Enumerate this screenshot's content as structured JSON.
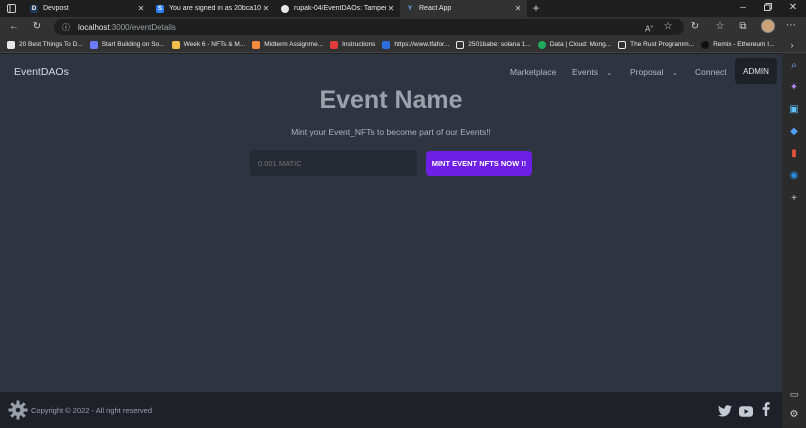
{
  "browser": {
    "tabs": [
      {
        "title": "Devpost",
        "favicon": "D",
        "color": "#1f3b57",
        "active": false
      },
      {
        "title": "You are signed in as 20bca102",
        "favicon": "S",
        "color": "#2d7ff9",
        "active": false
      },
      {
        "title": "rupak-04/EventDAOs: Tamper Pr",
        "favicon": "github-icon",
        "color": "#111111",
        "active": false
      },
      {
        "title": "React App",
        "favicon": "Y",
        "color": "#323233",
        "active": true
      }
    ],
    "address": {
      "host": "localhost",
      "path": ":3000/eventDetails"
    },
    "bookmarks": [
      {
        "label": "20 Best Things To D...",
        "color": "#e8e8e8"
      },
      {
        "label": "Start Building on So...",
        "color": "#6b7cff"
      },
      {
        "label": "Week 6 - NFTs & M...",
        "color": "#f0c04a"
      },
      {
        "label": "Midterm Assignme...",
        "color": "#ff8a3d"
      },
      {
        "label": "Instructions",
        "color": "#e23c3c"
      },
      {
        "label": "https://www.tfafor...",
        "color": "#2e6fe0"
      },
      {
        "label": "2501babe: solana 1...",
        "color": "#e8e8e8"
      },
      {
        "label": "Data | Cloud: Mong...",
        "color": "#1eaa5a"
      },
      {
        "label": "The Rust Programm...",
        "color": "#e8e8e8"
      },
      {
        "label": "Remix - Ethereum I...",
        "color": "#222222"
      }
    ]
  },
  "nav": {
    "brand": "EventDAOs",
    "links": [
      "Marketplace",
      "Events",
      "Proposal",
      "Connect"
    ],
    "admin": "ADMIN"
  },
  "hero": {
    "title": "Event Name",
    "subtitle": "Mint your Event_NFTs to become part of our Events!!",
    "price_placeholder": "0.001 MATIC",
    "mint_label": "MINT EVENT NFTS NOW !!"
  },
  "footer": {
    "copyright": "Copyright © 2022 - All right reserved",
    "social_icons": [
      "twitter-icon",
      "youtube-icon",
      "facebook-icon"
    ]
  },
  "colors": {
    "page_bg": "#2f3441",
    "footer_bg": "#1e2128",
    "accent": "#6d1fe6"
  }
}
